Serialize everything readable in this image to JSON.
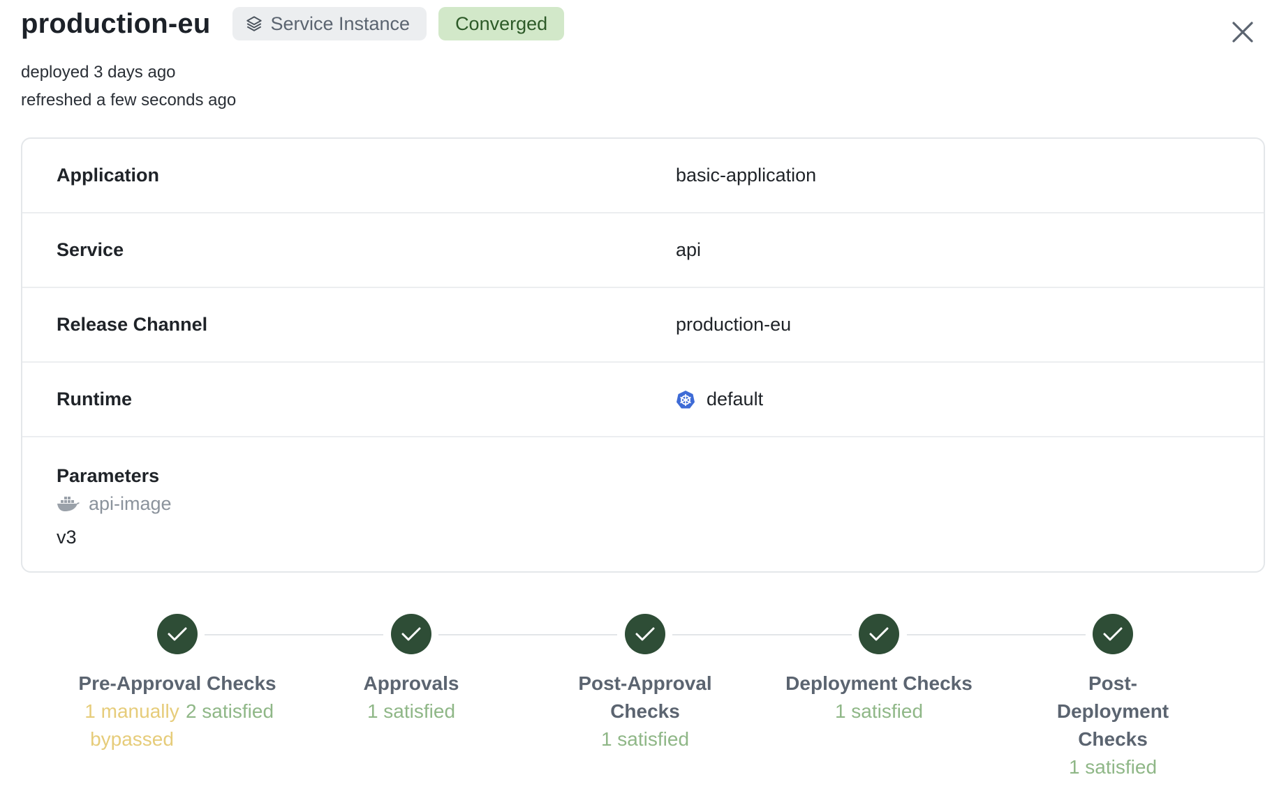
{
  "header": {
    "title": "production-eu",
    "type_badge": "Service Instance",
    "status_badge": "Converged",
    "deployed": "deployed 3 days ago",
    "refreshed": "refreshed a few seconds ago"
  },
  "details": {
    "application": {
      "label": "Application",
      "value": "basic-application"
    },
    "service": {
      "label": "Service",
      "value": "api"
    },
    "release_channel": {
      "label": "Release Channel",
      "value": "production-eu"
    },
    "runtime": {
      "label": "Runtime",
      "value": "default",
      "icon": "kubernetes-icon"
    },
    "parameters": {
      "label": "Parameters",
      "items": [
        {
          "name": "api-image",
          "icon": "docker-icon",
          "value": "v3"
        }
      ]
    }
  },
  "steps": [
    {
      "name": "Pre-Approval Checks",
      "bypassed": "1 manually bypassed",
      "satisfied": "2 satisfied",
      "status": "complete"
    },
    {
      "name": "Approvals",
      "satisfied": "1 satisfied",
      "status": "complete"
    },
    {
      "name": "Post-Approval Checks",
      "satisfied": "1 satisfied",
      "status": "complete"
    },
    {
      "name": "Deployment Checks",
      "satisfied": "1 satisfied",
      "status": "complete"
    },
    {
      "name": "Post-Deployment Checks",
      "satisfied": "1 satisfied",
      "status": "complete"
    }
  ],
  "colors": {
    "complete": "#2e4d36",
    "satisfied": "#8fb787",
    "bypassed": "#e6cc7a",
    "converged_bg": "#d2e8c9"
  }
}
